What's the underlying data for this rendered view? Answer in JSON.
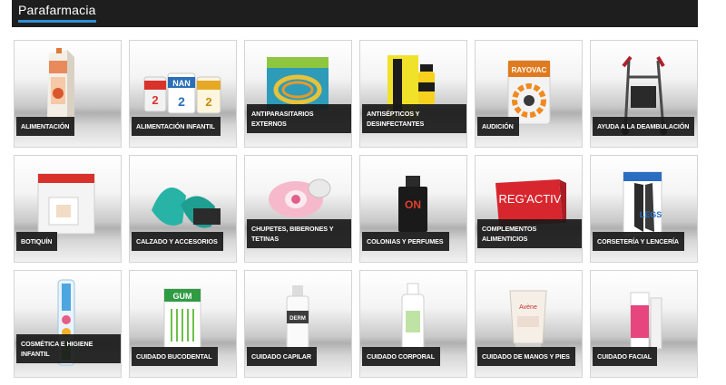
{
  "header": {
    "title": "Parafarmacia",
    "accent_color": "#2f8fd6"
  },
  "categories": [
    {
      "label": "ALIMENTACIÓN",
      "icon": "milk-carton"
    },
    {
      "label": "ALIMENTACIÓN INFANTIL",
      "icon": "formula-tins"
    },
    {
      "label": "ANTIPARASITARIOS EXTERNOS",
      "icon": "pet-collar"
    },
    {
      "label": "ANTISÉPTICOS Y DESINFECTANTES",
      "icon": "antiseptic-box"
    },
    {
      "label": "AUDICIÓN",
      "icon": "hearing-batteries"
    },
    {
      "label": "AYUDA A LA DEAMBULACIÓN",
      "icon": "walker"
    },
    {
      "label": "BOTIQUÍN",
      "icon": "bandage-pack"
    },
    {
      "label": "CALZADO Y ACCESORIOS",
      "icon": "foldable-shoes"
    },
    {
      "label": "CHUPETES, BIBERONES Y TETINAS",
      "icon": "pacifier"
    },
    {
      "label": "COLONIAS Y PERFUMES",
      "icon": "perfume-bottle"
    },
    {
      "label": "COMPLEMENTOS ALIMENTICIOS",
      "icon": "supplement-box"
    },
    {
      "label": "CORSETERÍA Y LENCERÍA",
      "icon": "compression-stockings"
    },
    {
      "label": "COSMÉTICA E HIGIENE INFANTIL",
      "icon": "kids-toothbrush"
    },
    {
      "label": "CUIDADO BUCODENTAL",
      "icon": "interdental-brushes"
    },
    {
      "label": "CUIDADO CAPILAR",
      "icon": "hair-spray"
    },
    {
      "label": "CUIDADO CORPORAL",
      "icon": "body-lotion"
    },
    {
      "label": "CUIDADO DE MANOS Y PIES",
      "icon": "hand-cream"
    },
    {
      "label": "CUIDADO FACIAL",
      "icon": "facial-serum"
    }
  ]
}
